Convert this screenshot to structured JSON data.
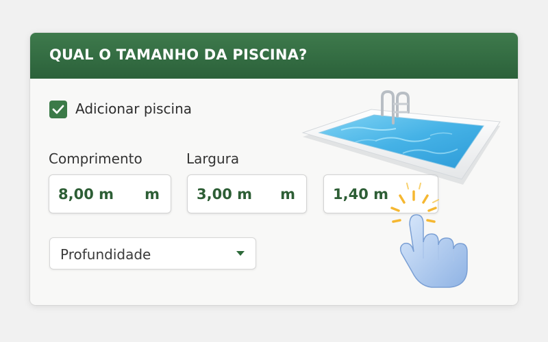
{
  "header": {
    "title": "QUAL O TAMANHO DA PISCINA?"
  },
  "add_pool": {
    "checked": true,
    "label": "Adicionar piscina"
  },
  "fields": {
    "length": {
      "label": "Comprimento",
      "value": "8,00 m",
      "unit": "m"
    },
    "width": {
      "label": "Largura",
      "value": "3,00 m",
      "unit": "m"
    },
    "depth": {
      "value": "1,40 m"
    }
  },
  "depth_select": {
    "selected": "Profundidade"
  },
  "colors": {
    "header_green": "#2b613a",
    "accent_green": "#3b7a48",
    "value_text": "#2d5e35",
    "pool_water": "#4db8e8"
  },
  "icons": [
    "check-icon",
    "chevron-down-icon",
    "pool-illustration",
    "pointing-hand-icon"
  ]
}
